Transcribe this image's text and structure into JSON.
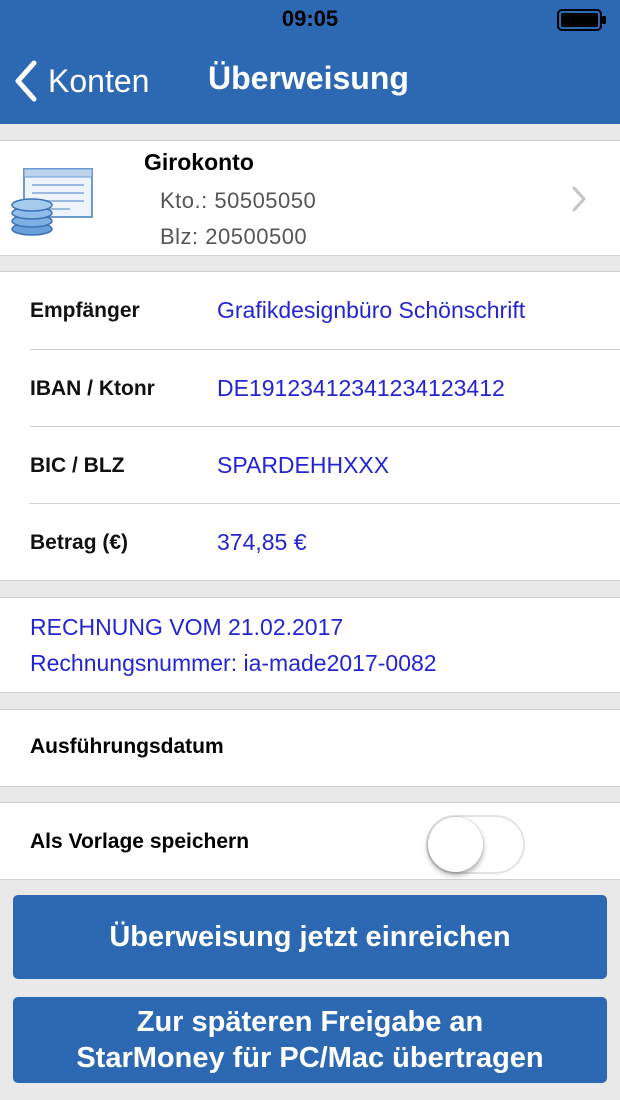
{
  "status_bar": {
    "time": "09:05",
    "battery_icon": "battery-full-icon"
  },
  "nav": {
    "back_label": "Konten",
    "title": "Überweisung",
    "back_icon": "chevron-left-icon"
  },
  "account": {
    "name": "Girokonto",
    "kto": "Kto.: 50505050",
    "blz": "Blz: 20500500",
    "icon": "account-stack-icon"
  },
  "fields": [
    {
      "label": "Empfänger",
      "value": "Grafikdesignbüro Schönschrift"
    },
    {
      "label": "IBAN / Ktonr",
      "value": "DE19123412341234123412"
    },
    {
      "label": "BIC / BLZ",
      "value": "SPARDEHHXXX"
    },
    {
      "label": "Betrag (€)",
      "value": "374,85 €"
    }
  ],
  "memo": {
    "line1": "RECHNUNG VOM 21.02.2017",
    "line2": "Rechnungsnummer: ia-made2017-0082"
  },
  "execution_date": {
    "label": "Ausführungsdatum"
  },
  "save_template": {
    "label": "Als Vorlage speichern",
    "enabled": false
  },
  "buttons": {
    "submit": "Überweisung jetzt einreichen",
    "later_line1": "Zur späteren Freigabe an",
    "later_line2": "StarMoney für PC/Mac übertragen"
  },
  "colors": {
    "brand": "#2d69b3",
    "value_text": "#2524d1",
    "background": "#e9e9e9"
  }
}
